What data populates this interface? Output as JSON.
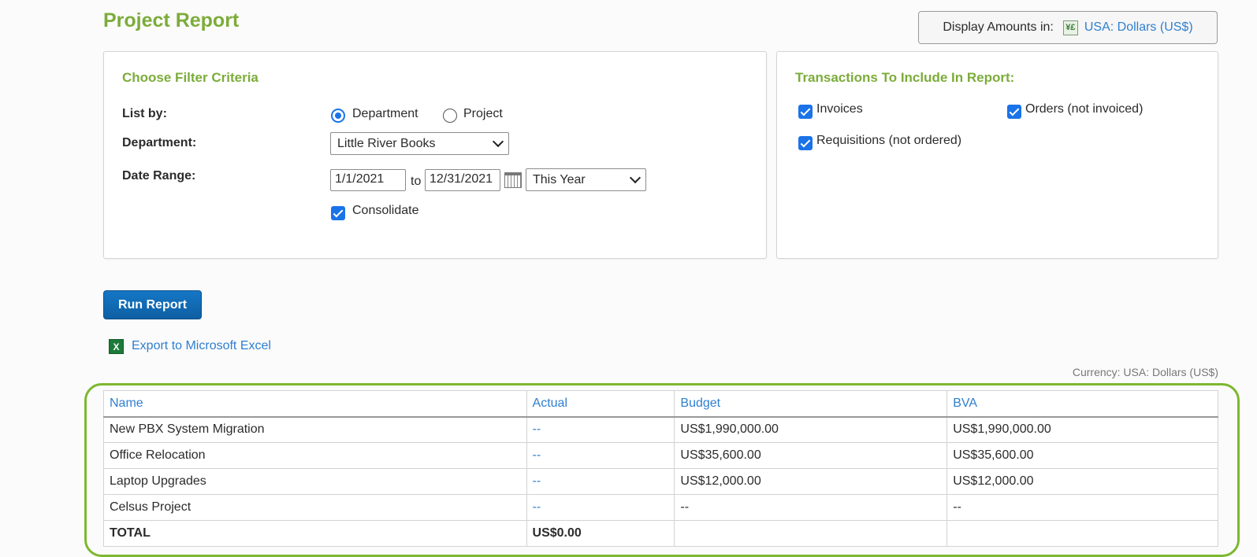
{
  "page": {
    "title": "Project Report",
    "display_amounts_label": "Display Amounts in:",
    "display_currency": "USA: Dollars (US$)",
    "currency_icon": "currency-icon"
  },
  "filter": {
    "heading": "Choose Filter Criteria",
    "list_by_label": "List by:",
    "list_by_options": [
      "Department",
      "Project"
    ],
    "list_by_selected": "Department",
    "department_label": "Department:",
    "department_value": "Little River Books",
    "date_range_label": "Date Range:",
    "date_from": "1/1/2021",
    "date_to_word": "to",
    "date_to": "12/31/2021",
    "date_preset": "This Year",
    "consolidate_label": "Consolidate",
    "consolidate_checked": true
  },
  "transactions": {
    "heading": "Transactions To Include In Report:",
    "items": [
      {
        "label": "Invoices",
        "checked": true
      },
      {
        "label": "Orders (not invoiced)",
        "checked": true
      },
      {
        "label": "Requisitions (not ordered)",
        "checked": true
      }
    ]
  },
  "actions": {
    "run_report": "Run Report",
    "export_excel": "Export to Microsoft Excel"
  },
  "report": {
    "currency_note": "Currency: USA: Dollars (US$)",
    "columns": [
      "Name",
      "Actual",
      "Budget",
      "BVA"
    ],
    "rows": [
      {
        "name": "New PBX System Migration",
        "actual": "--",
        "budget": "US$1,990,000.00",
        "bva": "US$1,990,000.00"
      },
      {
        "name": "Office Relocation",
        "actual": "--",
        "budget": "US$35,600.00",
        "bva": "US$35,600.00"
      },
      {
        "name": "Laptop Upgrades",
        "actual": "--",
        "budget": "US$12,000.00",
        "bva": "US$12,000.00"
      },
      {
        "name": "Celsus Project",
        "actual": "--",
        "budget": "--",
        "bva": "--"
      }
    ],
    "total": {
      "name": "TOTAL",
      "actual": "US$0.00",
      "budget": "",
      "bva": ""
    }
  },
  "colors": {
    "accent_green": "#7cac3a",
    "link_blue": "#2f7fd0",
    "button_blue": "#1477c6",
    "highlight_frame": "#7cb82f"
  }
}
